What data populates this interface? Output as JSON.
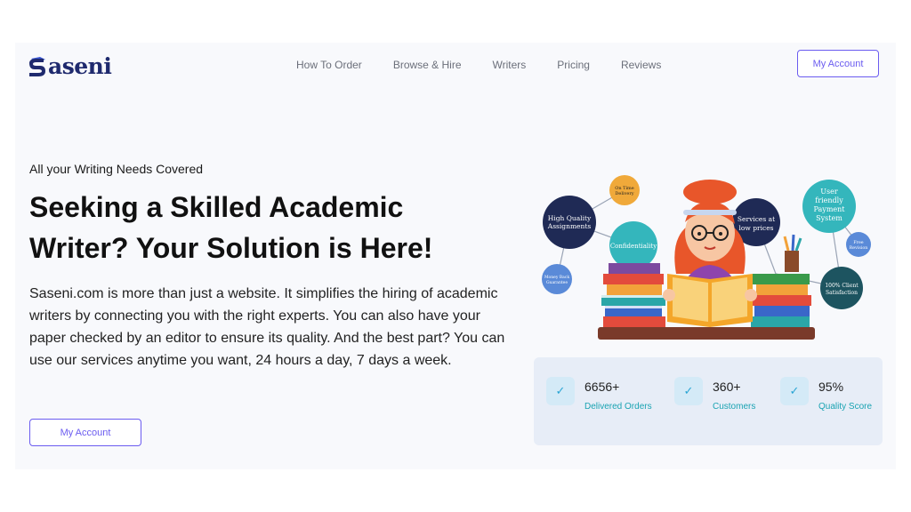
{
  "brand": {
    "name": "aseni",
    "logo_letter": "S"
  },
  "nav": {
    "items": [
      "How To Order",
      "Browse & Hire",
      "Writers",
      "Pricing",
      "Reviews"
    ],
    "account_button": "My Account"
  },
  "hero": {
    "eyebrow": "All your Writing Needs Covered",
    "headline": "Seeking a Skilled Academic Writer? Your Solution is Here!",
    "description": "Saseni.com is more than just a website. It simplifies the hiring of academic writers by connecting you with the right experts. You can also have your paper checked by an editor to ensure its quality. And the best part? You can use our services anytime you want, 24 hours a day, 7 days a week.",
    "cta": "My Account"
  },
  "illustration": {
    "bubbles": {
      "high_quality": [
        "High Quality",
        "Assignments"
      ],
      "on_time": [
        "On Time",
        "Delivery"
      ],
      "confidentiality": [
        "Confidentiality"
      ],
      "low_prices": [
        "Services at",
        "low prices"
      ],
      "payment": [
        "User",
        "friendly",
        "Payment",
        "System"
      ],
      "revision": [
        "Free",
        "Revision"
      ],
      "money_back": [
        "Money Back",
        "Guarantee"
      ],
      "satisfaction": [
        "100% Client",
        "Satisfaction"
      ]
    }
  },
  "stats": [
    {
      "value": "6656+",
      "label": "Delivered Orders"
    },
    {
      "value": "360+",
      "label": "Customers"
    },
    {
      "value": "95%",
      "label": "Quality Score"
    }
  ],
  "colors": {
    "accent": "#6b5cf0",
    "navy": "#1f2a6e",
    "teal": "#1aa3b2"
  }
}
